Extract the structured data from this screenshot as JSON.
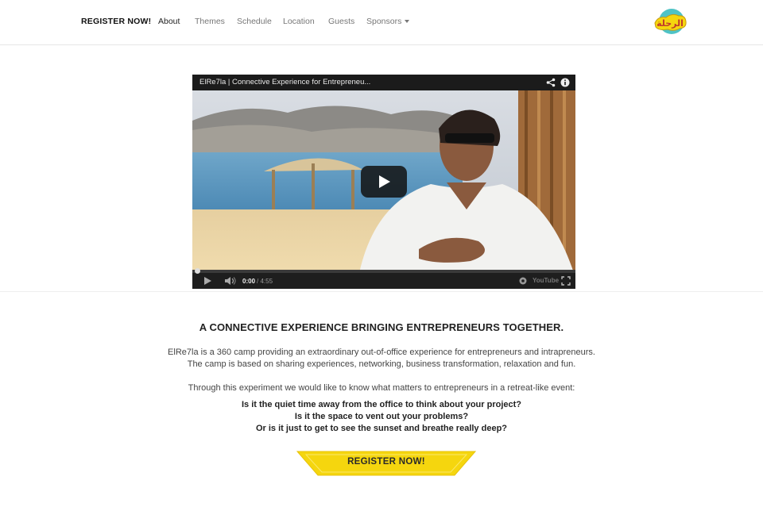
{
  "nav": {
    "register_label": "REGISTER NOW!",
    "items": [
      {
        "label": "About"
      },
      {
        "label": "Themes"
      },
      {
        "label": "Schedule"
      },
      {
        "label": "Location"
      },
      {
        "label": "Guests"
      },
      {
        "label": "Sponsors"
      }
    ],
    "logo_text": "الرحلة"
  },
  "video": {
    "title": "ElRe7la | Connective Experience for Entrepreneu...",
    "time_current": "0:00",
    "time_total": "/ 4:55",
    "progress_fraction": 0,
    "youtube_label": "YouTube",
    "icons": [
      "share-icon",
      "info-icon",
      "play-icon",
      "volume-icon",
      "settings-icon",
      "fullscreen-icon"
    ]
  },
  "content": {
    "headline": "A CONNECTIVE EXPERIENCE BRINGING ENTREPRENEURS TOGETHER.",
    "p1": "ElRe7la is a 360 camp providing an extraordinary out-of-office experience for entrepreneurs and intrapreneurs.",
    "p2": "The camp is based on sharing experiences, networking, business transformation, relaxation and fun.",
    "p3": "Through this experiment we would like to know what matters to entrepreneurs in a retreat-like event:",
    "questions": [
      "Is it the quiet time away from the office to think about your project?",
      "Is it the space to vent out your problems?",
      "Or is it just to get to see the sunset and breathe really deep?"
    ],
    "cta_label": "REGISTER NOW!"
  },
  "colors": {
    "accent_yellow": "#f5d60e",
    "nav_text": "#777777",
    "video_bar": "#1b1b1b",
    "logo_teal": "#4fc3c6"
  }
}
